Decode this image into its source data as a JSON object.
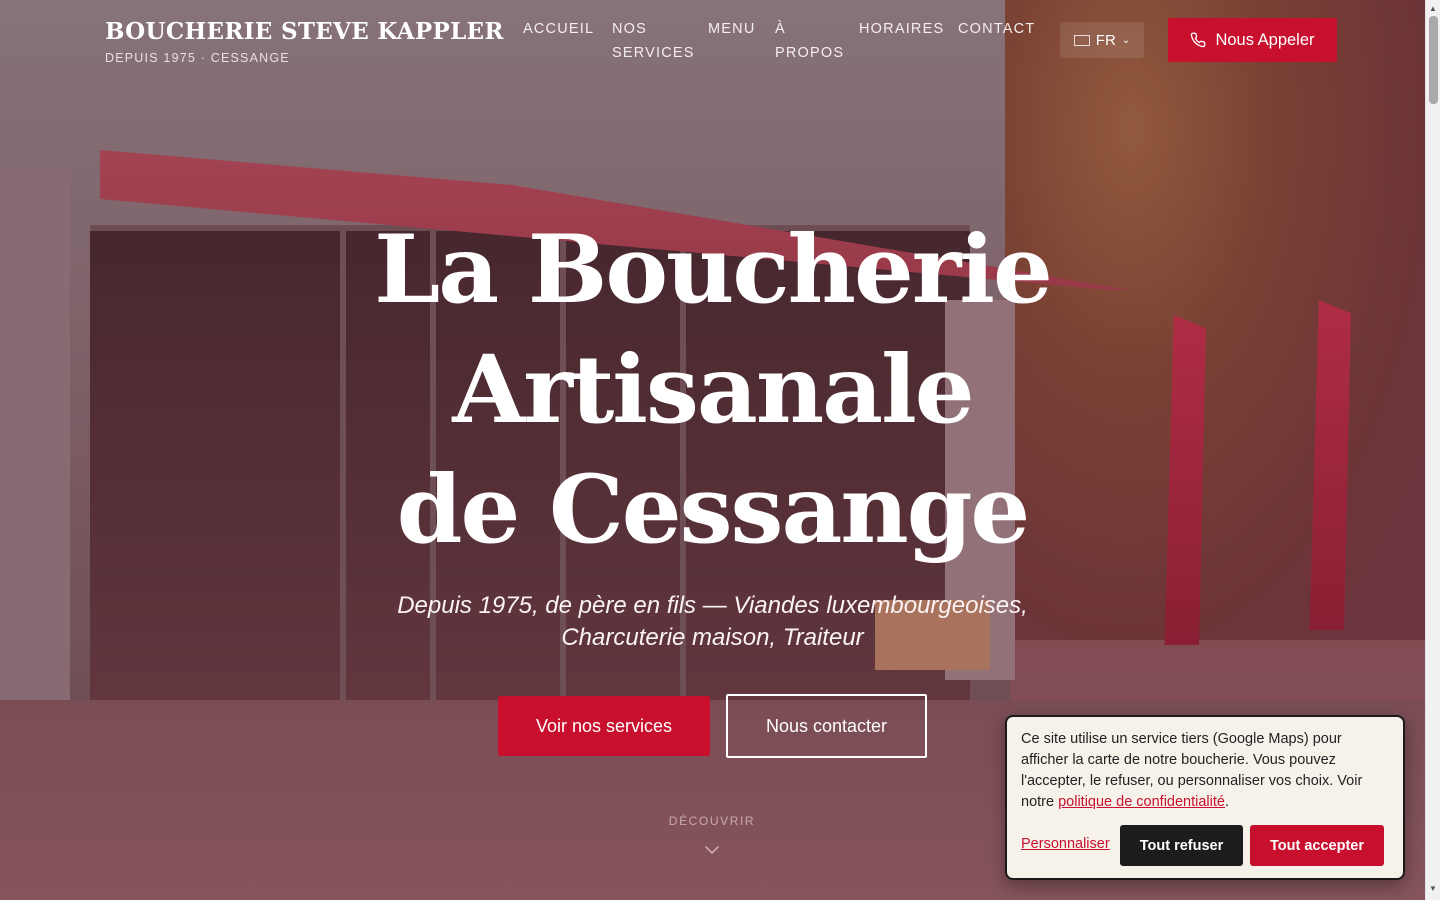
{
  "header": {
    "brand_name": "BOUCHERIE STEVE KAPPLER",
    "brand_sub": "DEPUIS 1975 · CESSANGE",
    "nav": [
      {
        "label": "ACCUEIL"
      },
      {
        "label": "NOS SERVICES"
      },
      {
        "label": "MENU"
      },
      {
        "label": "À PROPOS"
      },
      {
        "label": "HORAIRES"
      },
      {
        "label": "CONTACT"
      }
    ],
    "language": "FR",
    "call_button": "Nous Appeler"
  },
  "hero": {
    "title_line1": "La Boucherie",
    "title_line2": "Artisanale",
    "title_line3": "de Cessange",
    "subtitle_line1": "Depuis 1975, de père en fils — Viandes luxembourgeoises,",
    "subtitle_line2": "Charcuterie maison, Traiteur",
    "primary_button": "Voir nos services",
    "secondary_button": "Nous contacter",
    "discover": "DÉCOUVRIR"
  },
  "cookie": {
    "text_before_link": "Ce site utilise un service tiers (Google Maps) pour afficher la carte de notre boucherie. Vous pouvez l'accepter, le refuser, ou personnaliser vos choix. Voir notre ",
    "link": "politique de confidentialité",
    "text_after_link": ".",
    "customize": "Personnaliser",
    "refuse": "Tout refuser",
    "accept": "Tout accepter"
  },
  "colors": {
    "accent": "#c8102e",
    "dark_button": "#1c1c1c",
    "cookie_bg": "#f6f2ea"
  },
  "icons": {
    "phone": "phone-icon",
    "chevron": "chevron-down-icon",
    "flag": "flag-icon"
  }
}
